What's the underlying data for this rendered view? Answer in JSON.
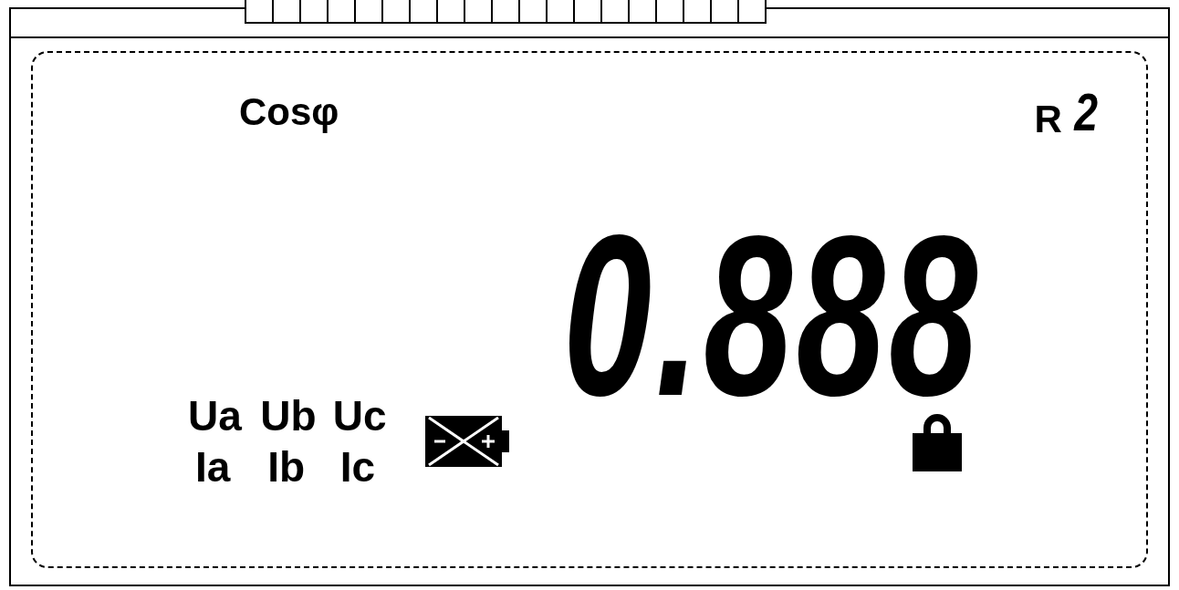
{
  "title": "Cosφ",
  "register": {
    "letter": "R",
    "digit": "2"
  },
  "reading": "0.888",
  "phases": {
    "voltages": [
      "Ua",
      "Ub",
      "Uc"
    ],
    "currents": [
      "Ia",
      "Ib",
      "Ic"
    ]
  },
  "battery_low": true,
  "locked": true
}
